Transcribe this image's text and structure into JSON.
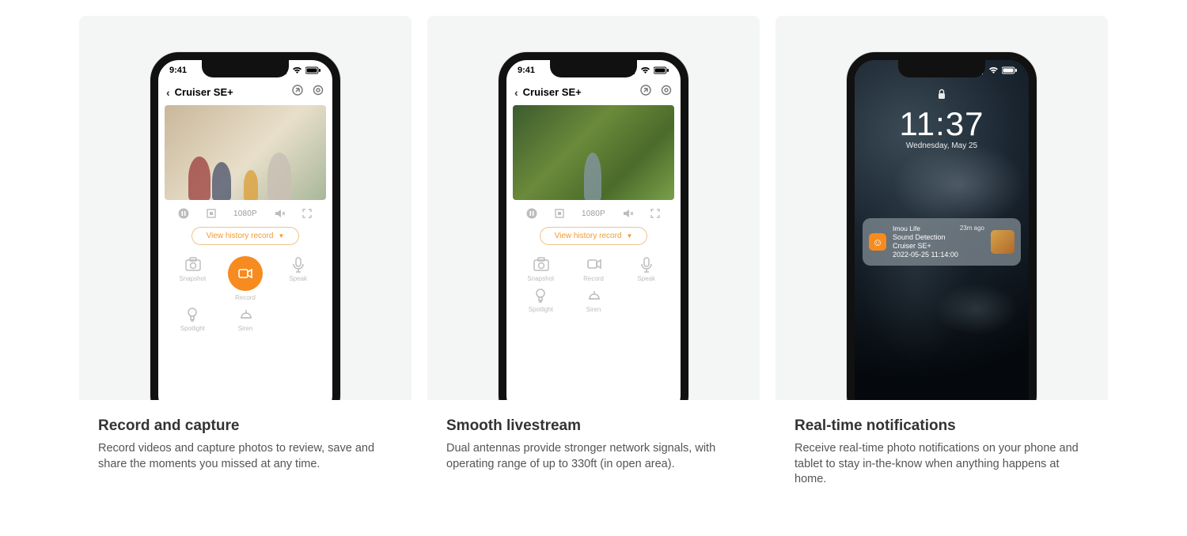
{
  "cards": [
    {
      "title": "Record and capture",
      "body": "Record videos and capture photos to review, save and share the moments you missed at any time."
    },
    {
      "title": "Smooth livestream",
      "body": "Dual antennas provide stronger network signals, with operating range of up to 330ft (in open area)."
    },
    {
      "title": "Real-time notifications",
      "body": "Receive real-time photo notifications on your phone and tablet to stay in-the-know when anything happens at home."
    }
  ],
  "app": {
    "status_time": "9:41",
    "device_name": "Cruiser SE+",
    "resolution": "1080P",
    "history_button": "View  history record",
    "buttons": {
      "snapshot": "Snapshot",
      "record": "Record",
      "speak": "Speak",
      "spotlight": "Spotlight",
      "siren": "Siren"
    }
  },
  "lockscreen": {
    "time": "11:37",
    "date": "Wednesday, May 25",
    "notif_app": "Imou Life",
    "notif_age": "23m ago",
    "notif_line2": "Sound Detection",
    "notif_line3": "Cruiser SE+",
    "notif_line4": "2022-05-25 11:14:00"
  },
  "colors": {
    "accent": "#f68b1f"
  }
}
